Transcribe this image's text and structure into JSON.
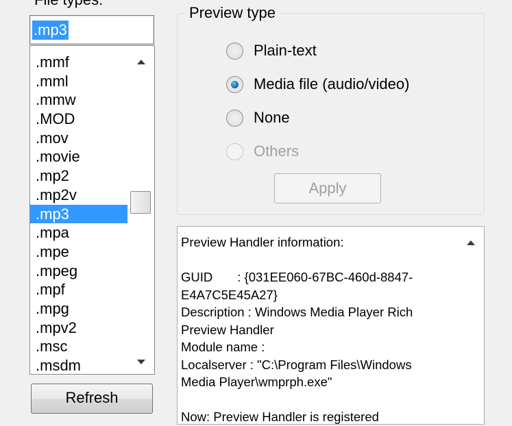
{
  "file_types": {
    "label": "File types:",
    "input_value": ".mp3",
    "list_items": [
      ".mmf",
      ".mml",
      ".mmw",
      ".MOD",
      ".mov",
      ".movie",
      ".mp2",
      ".mp2v",
      ".mp3",
      ".mpa",
      ".mpe",
      ".mpeg",
      ".mpf",
      ".mpg",
      ".mpv2",
      ".msc",
      ".msdm"
    ],
    "selected_item": ".mp3"
  },
  "refresh_button": {
    "label": "Refresh"
  },
  "preview_type": {
    "legend": "Preview type",
    "options": [
      {
        "label": "Plain-text",
        "checked": false,
        "enabled": true
      },
      {
        "label": "Media file (audio/video)",
        "checked": true,
        "enabled": true
      },
      {
        "label": "None",
        "checked": false,
        "enabled": true
      },
      {
        "label": "Others",
        "checked": false,
        "enabled": false
      }
    ],
    "apply_label": "Apply"
  },
  "handler_info": {
    "text": "Preview Handler information:\n\nGUID       : {031EE060-67BC-460d-8847-E4A7C5E45A27}\nDescription : Windows Media Player Rich Preview Handler\nModule name :\nLocalserver : \"C:\\Program Files\\Windows Media Player\\wmprph.exe\"\n\nNow: Preview Handler is registered"
  },
  "colors": {
    "selection": "#3399ff",
    "window_bg": "#f0f0f0"
  }
}
